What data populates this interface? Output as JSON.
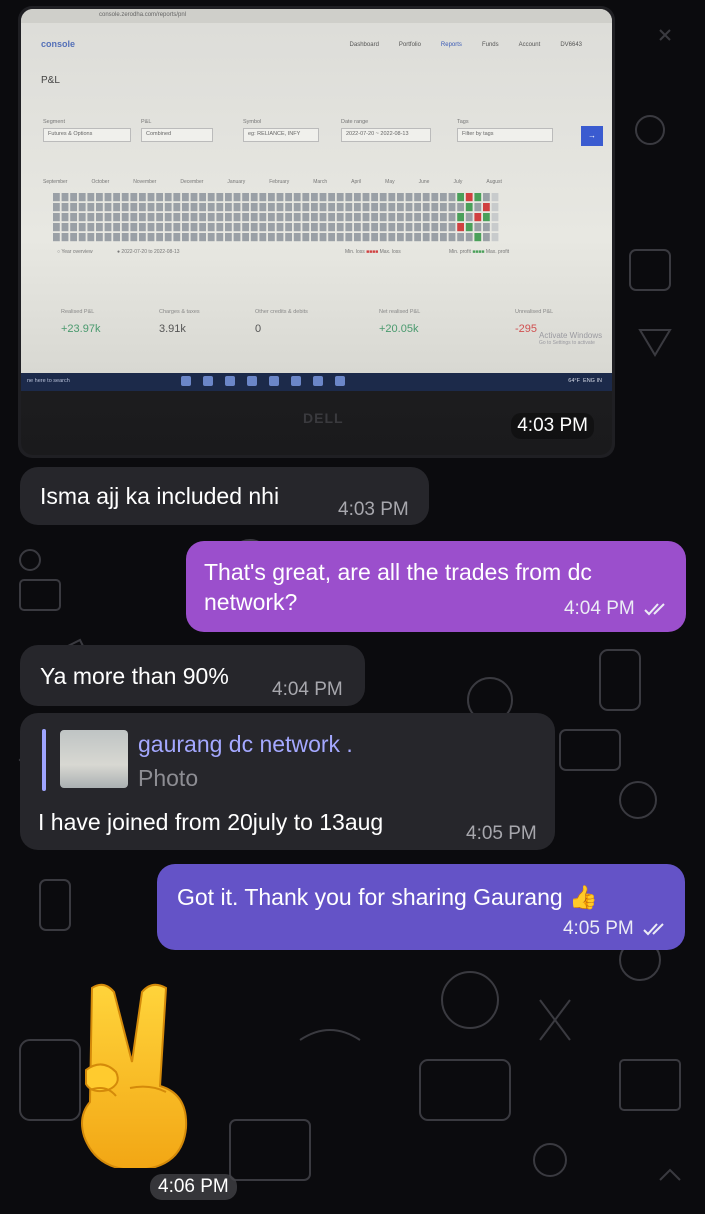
{
  "photo_message": {
    "time": "4:03 PM",
    "screenshot": {
      "url": "console.zerodha.com/reports/pnl",
      "logo": "console",
      "nav": [
        "Dashboard",
        "Portfolio",
        "Reports",
        "Funds",
        "Account"
      ],
      "user_id": "DV6643",
      "page_title": "P&L",
      "filters": {
        "segment_label": "Segment",
        "segment_value": "Futures & Options",
        "pl_label": "P&L",
        "pl_value": "Combined",
        "symbol_label": "Symbol",
        "symbol_placeholder": "eg: RELIANCE, INFY",
        "date_label": "Date range",
        "date_value": "2022-07-20 ~ 2022-08-13",
        "tags_label": "Tags",
        "tags_placeholder": "Filter by tags",
        "go": "→"
      },
      "months": [
        "September",
        "October",
        "November",
        "December",
        "January",
        "February",
        "March",
        "April",
        "May",
        "June",
        "July",
        "August"
      ],
      "legend": {
        "year_overview": "Year overview",
        "date_range": "2022-07-20 to 2022-08-13",
        "min_loss": "Min. loss",
        "max_loss": "Max. loss",
        "min_profit": "Min. profit",
        "max_profit": "Max. profit"
      },
      "stats": [
        {
          "label": "Realised P&L",
          "value": "+23.97k",
          "color": "#4a9a6e"
        },
        {
          "label": "Charges & taxes",
          "value": "3.91k",
          "color": "#555555"
        },
        {
          "label": "Other credits & debits",
          "value": "0",
          "color": "#555555"
        },
        {
          "label": "Net realised P&L",
          "value": "+20.05k",
          "color": "#4a9a6e"
        },
        {
          "label": "Unrealised P&L",
          "value": "-295",
          "color": "#d05050"
        }
      ],
      "activate_windows": "Activate Windows",
      "activate_windows_sub": "Go to Settings to activate",
      "taskbar_search": "ne here to search",
      "weather": "64°F",
      "lang": "ENG IN",
      "laptop_brand": "DELL"
    }
  },
  "messages": [
    {
      "id": "m1",
      "text": "Isma ajj ka included nhi",
      "time": "4:03 PM"
    },
    {
      "id": "m2",
      "text_line1": "That's great, are all the trades from dc",
      "text_line2": "network?",
      "time": "4:04 PM"
    },
    {
      "id": "m3",
      "text": "Ya more than 90%",
      "time": "4:04 PM"
    },
    {
      "id": "m4",
      "reply_name": "gaurang dc network .",
      "reply_type": "Photo",
      "text": "I have joined from 20july to 13aug",
      "time": "4:05 PM"
    },
    {
      "id": "m5",
      "text": "Got it. Thank you for sharing Gaurang",
      "emoji": "👍",
      "time": "4:05 PM"
    }
  ],
  "sticker": {
    "emoji": "victory-hand",
    "time": "4:06 PM"
  },
  "colors": {
    "background": "#0b0b0e",
    "incoming_bubble": "#26262b",
    "outgoing_purple": "#9b4fcc",
    "outgoing_blue": "#6453c7",
    "reply_accent": "#a4a8ff"
  }
}
